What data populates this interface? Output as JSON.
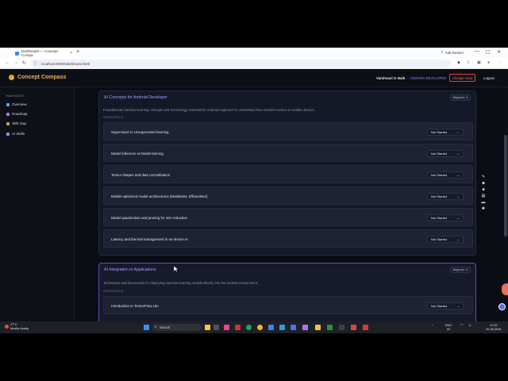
{
  "browser": {
    "tab_title": "Dashboard — Concept Compa",
    "tab_close": "×",
    "new_tab": "+",
    "ask": "Ask Gemini",
    "url": "localhost:8080/dashboard.html"
  },
  "header": {
    "brand": "Concept Compass",
    "user_name": "Vaishnavi G Naik",
    "role": "ANDROID DEVELOPER",
    "change_goal": "Change Goal",
    "logout": "Logout"
  },
  "sidebar": {
    "heading": "NAVIGATE",
    "items": [
      {
        "label": "Overview",
        "color": "#5aa7ff"
      },
      {
        "label": "Roadmap",
        "color": "#9c7bff"
      },
      {
        "label": "Skill Gap",
        "color": "#c9a24a"
      },
      {
        "label": "AI Skills",
        "color": "#8a92ff"
      }
    ]
  },
  "cards": [
    {
      "title": "AI Concepts for Android Developer",
      "level": "Beginner",
      "description": "Foundational machine learning concepts and terminology essential for Android engineers to understand how models function on mobile devices.",
      "subtopics_label": "SUBTOPICS",
      "subtopics": [
        {
          "label": "Supervised vs Unsupervised learning",
          "status": "Not Started"
        },
        {
          "label": "Model inference vs Model training",
          "status": "Not Started"
        },
        {
          "label": "Tensor shapes and data normalization",
          "status": "Not Started"
        },
        {
          "label": "Mobile-optimized model architectures (MobileNet, EfficientNet)",
          "status": "Not Started"
        },
        {
          "label": "Model quantization and pruning for size reduction",
          "status": "Not Started"
        },
        {
          "label": "Latency and thermal management in on-device AI",
          "status": "Not Started"
        }
      ]
    },
    {
      "title": "AI Integration in Applications",
      "level": "Beginner",
      "description": "Techniques and frameworks for deploying machine learning models directly into the Android environment.",
      "subtopics_label": "SUBTOPICS",
      "subtopics": [
        {
          "label": "Introduction to TensorFlow Lite",
          "status": "Not Started"
        }
      ]
    }
  ],
  "taskbar": {
    "temp": "27°C",
    "weather": "Mostly cloudy",
    "search_placeholder": "Search",
    "lang_top": "ENG",
    "lang_bottom": "IN",
    "time": "17:02",
    "date": "20-08-2026"
  }
}
